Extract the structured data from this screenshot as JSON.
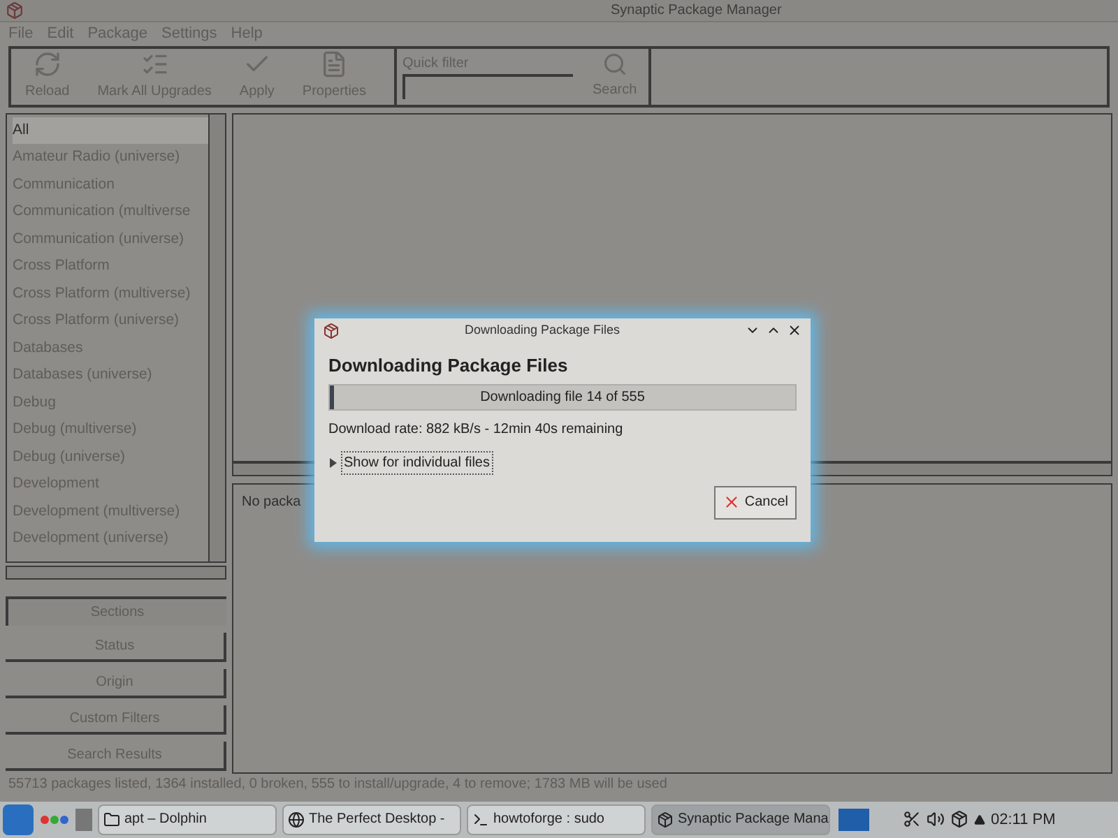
{
  "window": {
    "title": "Synaptic Package Manager"
  },
  "menu": [
    "File",
    "Edit",
    "Package",
    "Settings",
    "Help"
  ],
  "toolbar": [
    {
      "label": "Reload",
      "kind": "reload"
    },
    {
      "label": "Mark All Upgrades",
      "kind": "upgrades"
    },
    {
      "label": "Apply",
      "kind": "apply"
    },
    {
      "label": "Properties",
      "kind": "properties"
    }
  ],
  "quick_filter": {
    "label": "Quick filter"
  },
  "search_button": {
    "label": "Search"
  },
  "sections": [
    {
      "label": "All",
      "selected": true
    },
    {
      "label": "Amateur Radio (universe)",
      "selected": false
    },
    {
      "label": "Communication",
      "selected": false
    },
    {
      "label": "Communication (multiverse",
      "selected": false
    },
    {
      "label": "Communication (universe)",
      "selected": false
    },
    {
      "label": "Cross Platform",
      "selected": false
    },
    {
      "label": "Cross Platform (multiverse)",
      "selected": false
    },
    {
      "label": "Cross Platform (universe)",
      "selected": false
    },
    {
      "label": "Databases",
      "selected": false
    },
    {
      "label": "Databases (universe)",
      "selected": false
    },
    {
      "label": "Debug",
      "selected": false
    },
    {
      "label": "Debug (multiverse)",
      "selected": false
    },
    {
      "label": "Debug (universe)",
      "selected": false
    },
    {
      "label": "Development",
      "selected": false
    },
    {
      "label": "Development (multiverse)",
      "selected": false
    },
    {
      "label": "Development (universe)",
      "selected": false
    }
  ],
  "filter_buttons": [
    {
      "label": "Sections",
      "selected": true
    },
    {
      "label": "Status",
      "selected": false
    },
    {
      "label": "Origin",
      "selected": false
    },
    {
      "label": "Custom Filters",
      "selected": false
    },
    {
      "label": "Search Results",
      "selected": false
    }
  ],
  "details": {
    "text": "No packa"
  },
  "status_bar": "55713 packages listed, 1364 installed, 0 broken, 555 to install/upgrade, 4 to remove; 1783 MB will be used",
  "dialog": {
    "title": "Downloading Package Files",
    "heading": "Downloading Package Files",
    "progress": {
      "text": "Downloading file 14 of 555",
      "level": 0.025
    },
    "rate": "Download rate: 882 kB/s - 12min 40s remaining",
    "expander": {
      "label": "Show for individual files",
      "expanded": false
    },
    "cancel": "Cancel"
  },
  "taskbar": {
    "tasks": [
      {
        "label": "apt – Dolphin",
        "kind": "files",
        "selected": false
      },
      {
        "label": "The Perfect Desktop -",
        "kind": "browser",
        "selected": false
      },
      {
        "label": "howtoforge : sudo",
        "kind": "terminal",
        "selected": false
      },
      {
        "label": "Synaptic Package Mana",
        "kind": "package",
        "selected": true
      }
    ],
    "clock": "02:11 PM"
  }
}
